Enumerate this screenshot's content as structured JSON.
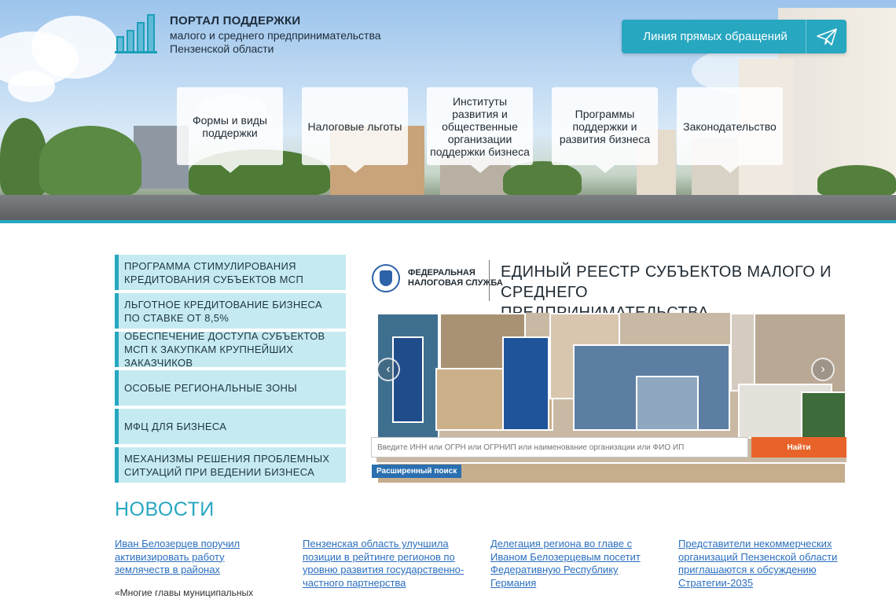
{
  "header": {
    "title": "ПОРТАЛ ПОДДЕРЖКИ",
    "subtitle_line1": "малого и среднего предпринимательства",
    "subtitle_line2": "Пензенской области",
    "hotline_label": "Линия прямых обращений"
  },
  "nav": [
    {
      "label": "Формы и виды поддержки"
    },
    {
      "label": "Налоговые льготы"
    },
    {
      "label": "Институты развития и общественные организации поддержки бизнеса"
    },
    {
      "label": "Программы поддержки и развития бизнеса"
    },
    {
      "label": "Законодательство"
    }
  ],
  "sidebar": [
    {
      "label": "ПРОГРАММА СТИМУЛИРОВАНИЯ КРЕДИТОВАНИЯ СУБЪЕКТОВ МСП"
    },
    {
      "label": "ЛЬГОТНОЕ КРЕДИТОВАНИЕ БИЗНЕСА ПО СТАВКЕ ОТ 8,5%"
    },
    {
      "label": "ОБЕСПЕЧЕНИЕ ДОСТУПА СУБЪЕКТОВ МСП К ЗАКУПКАМ КРУПНЕЙШИХ ЗАКАЗЧИКОВ"
    },
    {
      "label": "ОСОБЫЕ РЕГИОНАЛЬНЫЕ ЗОНЫ"
    },
    {
      "label": "МФЦ ДЛЯ БИЗНЕСА"
    },
    {
      "label": "МЕХАНИЗМЫ РЕШЕНИЯ ПРОБЛЕМНЫХ СИТУАЦИЙ ПРИ ВЕДЕНИИ БИЗНЕСА"
    }
  ],
  "registry": {
    "fns_line1": "ФЕДЕРАЛЬНАЯ",
    "fns_line2": "НАЛОГОВАЯ СЛУЖБА",
    "title_line1": "ЕДИНЫЙ РЕЕСТР СУБЪЕКТОВ МАЛОГО И СРЕДНЕГО",
    "title_line2": "ПРЕДПРИНИМАТЕЛЬСТВА",
    "search_placeholder": "Введите ИНН или ОГРН или ОГРНИП или наименование организации или ФИО ИП",
    "search_button": "Найти",
    "advanced_search": "Расширенный поиск"
  },
  "news": {
    "heading": "НОВОСТИ",
    "items": [
      {
        "title": "Иван Белозерцев поручил активизировать работу землячеств в районах",
        "snippet": "«Многие главы муниципальных"
      },
      {
        "title": "Пензенская область улучшила позиции в рейтинге регионов по уровню развития государственно-частного партнерства",
        "snippet": ""
      },
      {
        "title": "Делегация региона во главе с Иваном Белозерцевым посетит Федеративную Республику Германия",
        "snippet": ""
      },
      {
        "title": "Представители некоммерческих организаций Пензенской области приглашаются к обсуждению Стратегии-2035",
        "snippet": ""
      }
    ]
  },
  "colors": {
    "accent": "#27a7c0",
    "sidebar_bg": "#c5ebf1",
    "link": "#2b6fbf",
    "search_button": "#e8632a",
    "advanced_search_bg": "#2a6fb0"
  },
  "icons": {
    "logo": "bar-chart-logo-icon",
    "hotline": "paper-plane-icon",
    "prev": "chevron-left-icon",
    "next": "chevron-right-icon",
    "fns": "fns-emblem-icon"
  }
}
